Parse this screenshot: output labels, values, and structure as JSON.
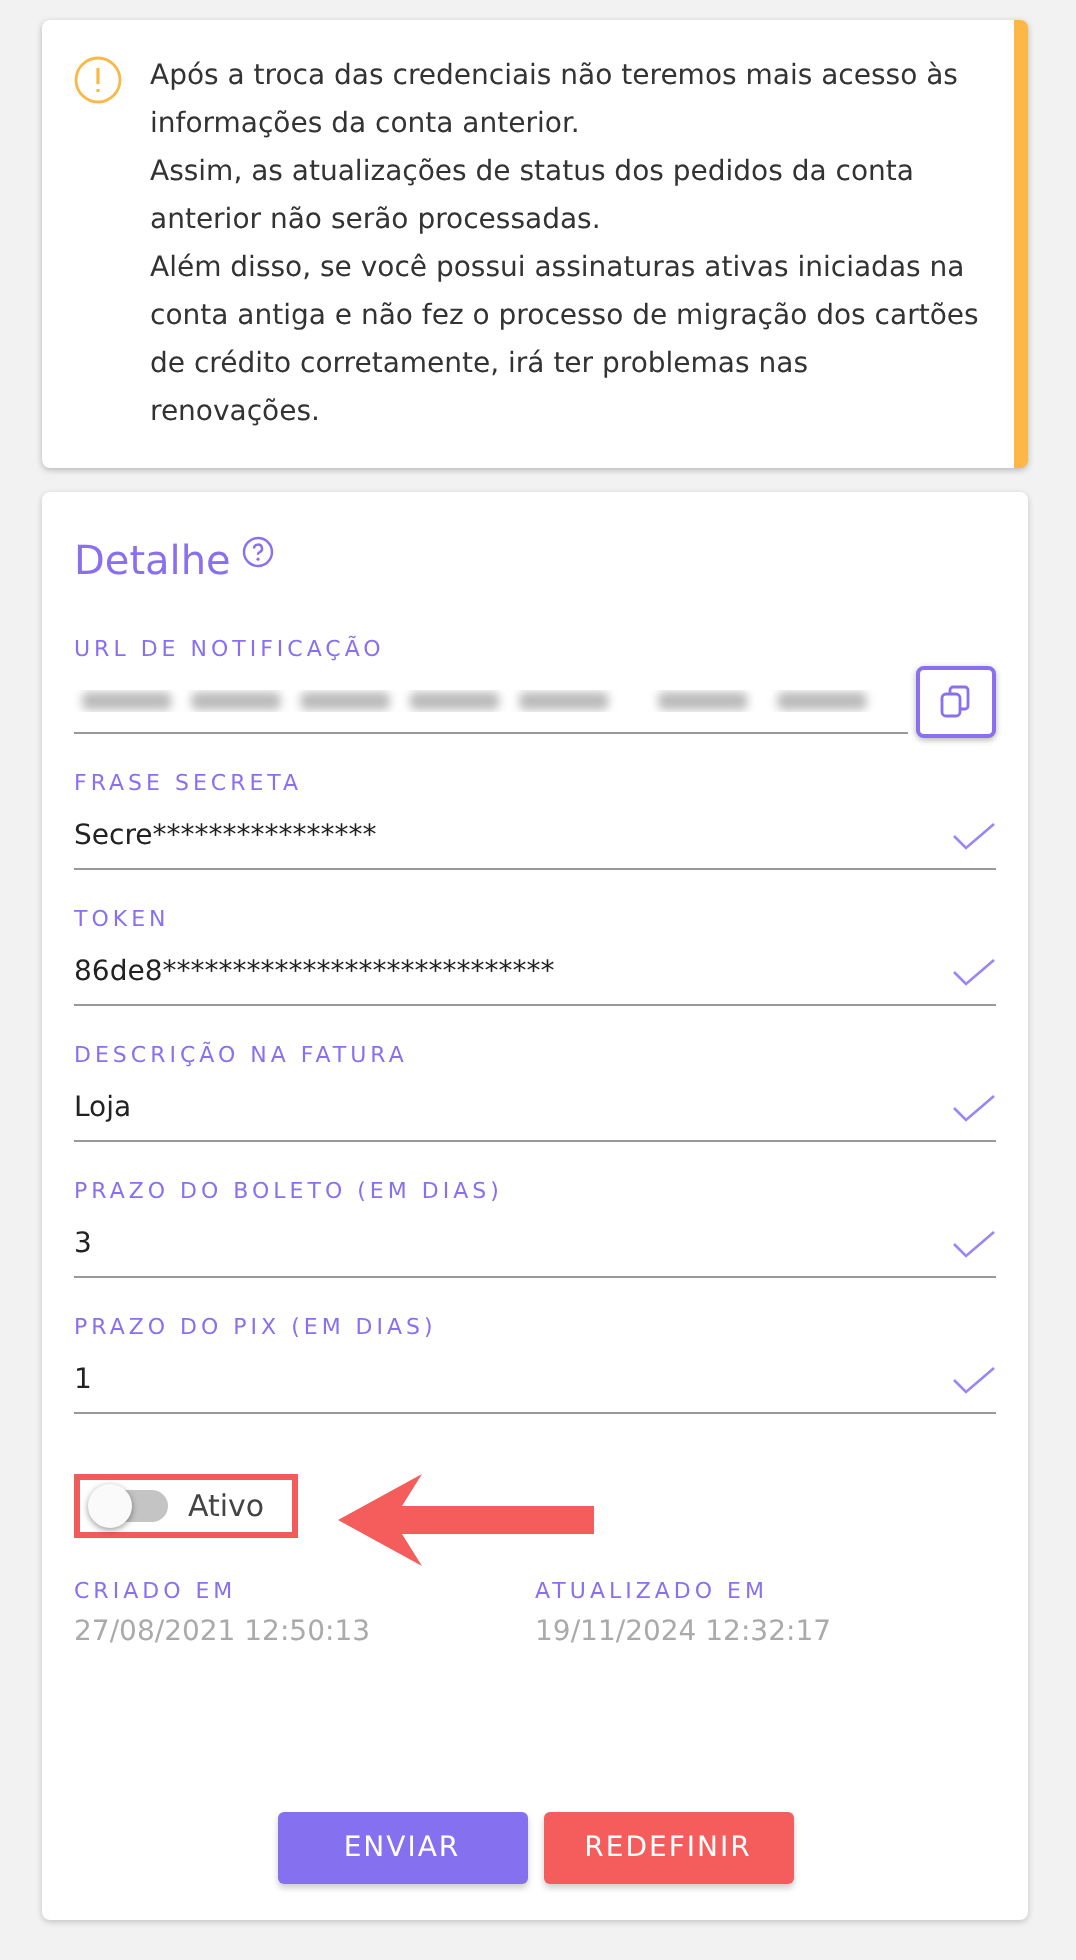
{
  "alert": {
    "lines": [
      "Após a troca das credenciais não teremos mais acesso às informações da conta anterior.",
      "Assim, as atualizações de status dos pedidos da conta anterior não serão processadas.",
      "Além disso, se você possui assinaturas ativas iniciadas na conta antiga e não fez o processo de migração dos cartões de crédito corretamente, irá ter problemas nas renovações."
    ]
  },
  "detail": {
    "title": "Detalhe",
    "fields": [
      {
        "kind": "url",
        "label": "URL DE NOTIFICAÇÃO"
      },
      {
        "kind": "text",
        "label": "FRASE SECRETA",
        "value": "Secre****************",
        "valid": true
      },
      {
        "kind": "text",
        "label": "TOKEN",
        "value": "86de8****************************",
        "valid": true
      },
      {
        "kind": "text",
        "label": "DESCRIÇÃO NA FATURA",
        "value": "Loja",
        "valid": true
      },
      {
        "kind": "text",
        "label": "PRAZO DO BOLETO (EM DIAS)",
        "value": "3",
        "valid": true
      },
      {
        "kind": "text",
        "label": "PRAZO DO PIX (EM DIAS)",
        "value": "1",
        "valid": true
      }
    ],
    "toggle": {
      "label": "Ativo",
      "on": false
    },
    "dates": [
      {
        "label": "CRIADO EM",
        "value": "27/08/2021 12:50:13"
      },
      {
        "label": "ATUALIZADO EM",
        "value": "19/11/2024 12:32:17"
      }
    ],
    "buttons": [
      {
        "kind": "primary",
        "label": "ENVIAR"
      },
      {
        "kind": "danger",
        "label": "REDEFINIR"
      }
    ]
  }
}
